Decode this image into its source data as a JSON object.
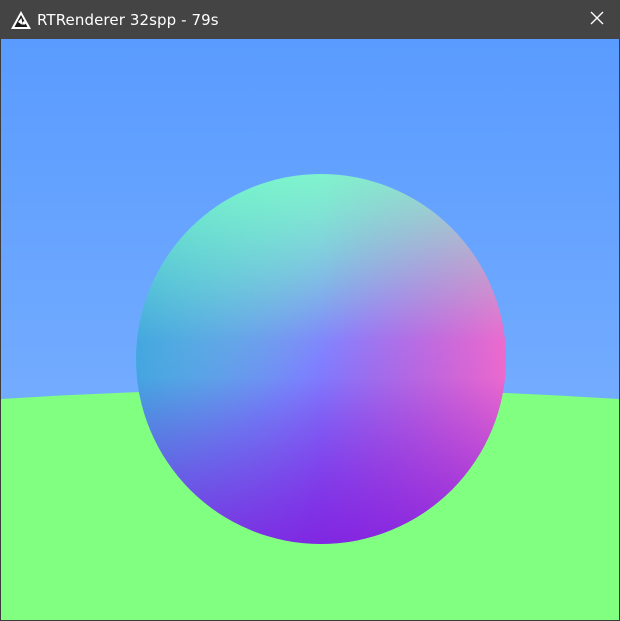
{
  "window": {
    "title": "RTRenderer 32spp - 79s",
    "app_icon": "triangle-logo-icon",
    "close_icon": "close-icon"
  },
  "scene": {
    "sky_top_color": "#5a9bff",
    "sky_horizon_color": "#82b6ff",
    "ground_color": "#80ff80",
    "sphere_colors": {
      "top": "#80ffc8",
      "left": "#3aa0e0",
      "center": "#8080ff",
      "right": "#ff70c8",
      "bottom": "#8020e0"
    }
  }
}
